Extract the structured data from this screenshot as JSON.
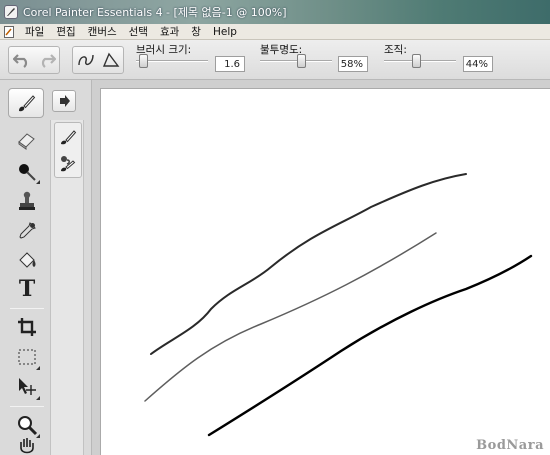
{
  "window": {
    "title": "Corel Painter Essentials 4 - [제목 없음-1 @ 100%]",
    "app_icon": "painter-brush-icon"
  },
  "menu": {
    "items": [
      "파일",
      "편집",
      "캔버스",
      "선택",
      "효과",
      "창",
      "Help"
    ]
  },
  "propbar": {
    "undo_icon": "undo-icon",
    "redo_icon": "redo-icon",
    "freehand_icon": "freehand-stroke-icon",
    "straight_icon": "straight-line-stroke-icon",
    "brush_size": {
      "label": "브러시 크기:",
      "value": "1.6",
      "level": 0.05
    },
    "opacity": {
      "label": "불투명도:",
      "value": "58%",
      "level": 0.58
    },
    "grain": {
      "label": "조직:",
      "value": "44%",
      "level": 0.44
    }
  },
  "toolbox": {
    "tools": [
      "eraser-icon",
      "dropper-blob-icon",
      "cloner-stamp-icon",
      "eyedropper-icon",
      "paint-bucket-icon",
      "text-icon",
      "crop-icon",
      "rectangle-select-icon",
      "transform-move-icon",
      "magnifier-icon",
      "grabber-hand-icon"
    ],
    "text_tool_glyph": "T",
    "sub_tools": [
      "brush-icon",
      "clone-brush-icon"
    ]
  },
  "canvas": {
    "watermark": "BodNara",
    "strokes": [
      {
        "name": "stroke-upper",
        "color": "#2a2a2a"
      },
      {
        "name": "stroke-middle",
        "color": "#5e5e5e"
      },
      {
        "name": "stroke-lower",
        "color": "#000000"
      }
    ]
  }
}
